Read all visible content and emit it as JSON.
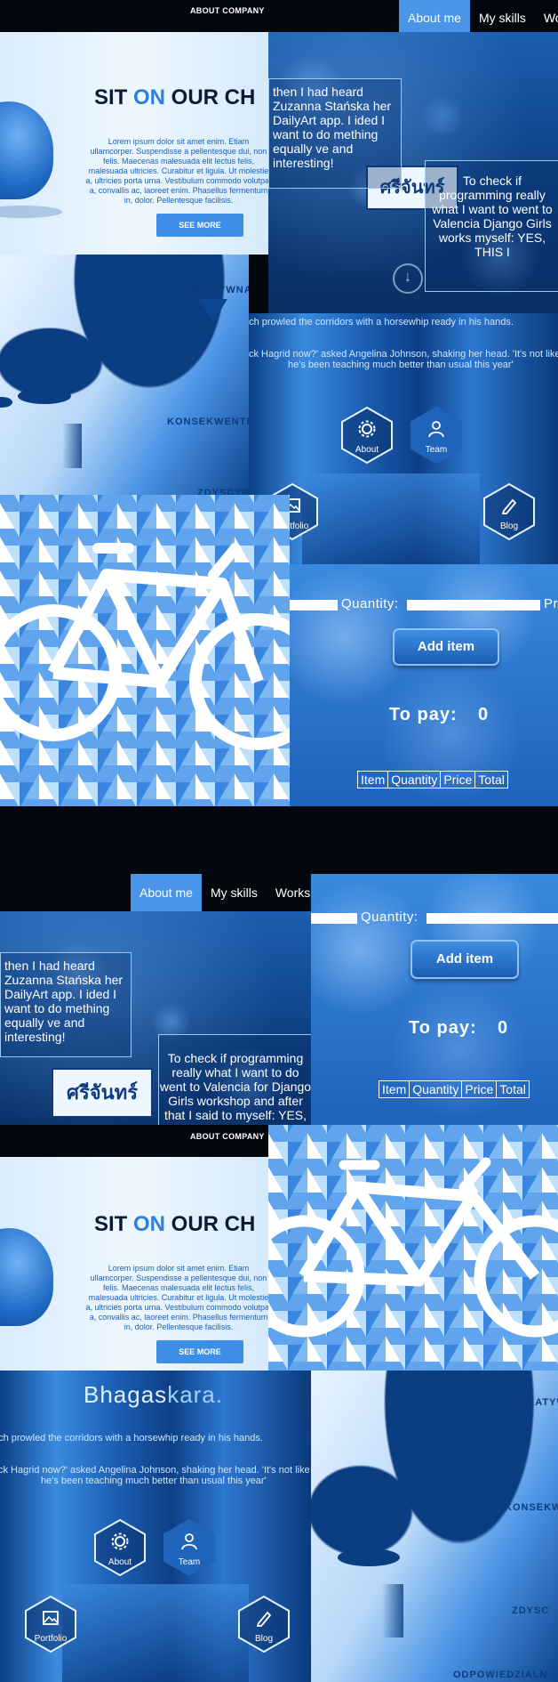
{
  "colors": {
    "accent": "#4a95e8",
    "deep_blue": "#0f4f99",
    "black": "#04070d",
    "white": "#ffffff"
  },
  "top_nav": {
    "about_company": "ABOUT COMPANY",
    "items": [
      {
        "label": "About me",
        "active": true
      },
      {
        "label": "My skills",
        "active": false
      },
      {
        "label": "Wo",
        "active": false
      }
    ]
  },
  "mid_nav": {
    "items": [
      {
        "label": "About me",
        "active": true
      },
      {
        "label": "My skills",
        "active": false
      },
      {
        "label": "Works",
        "active": false
      }
    ]
  },
  "hero": {
    "title_part1": "SIT ",
    "title_part2": "ON",
    "title_part3": " OUR CH",
    "body": "Lorem ipsum dolor sit amet enim. Etiam ullamcorper. Suspendisse a pellentesque dui, non felis. Maecenas malesuada elit lectus felis, malesuada ultricies. Curabitur et ligula. Ut molestie a, ultricies porta urna. Vestibulum commodo volutpat a, convallis ac, laoreet enim. Phasellus fermentum in, dolor. Pellentesque facilisis.",
    "button": "SEE MORE"
  },
  "hero_bottom": {
    "about_company": "ABOUT COMPANY",
    "title_part1": "SIT ",
    "title_part2": "ON",
    "title_part3": " OUR CH",
    "body": "Lorem ipsum dolor sit amet enim. Etiam ullamcorper. Suspendisse a pellentesque dui, non felis. Maecenas malesuada elit lectus felis, malesuada ultricies. Curabitur et ligula. Ut molestie a, ultricies porta urna. Vestibulum commodo volutpat a, convallis ac, laoreet enim. Phasellus fermentum in, dolor. Pellentesque facilisis.",
    "button": "SEE MORE"
  },
  "story": {
    "box1": "then I had heard Zuzanna Stańska her DailyArt app. I ided I want to do mething equally ve and interesting!",
    "box2": "To check if programming really what I want to went to Valencia Django Girls works myself: YES, THIS I",
    "sign": "ศรีจันทร์"
  },
  "story_bottom": {
    "box1": "then I had heard Zuzanna Stańska her DailyArt app. I ided I want to do mething equally ve and interesting!",
    "box2": "To check if programming really what I want to do went to Valencia for Django Girls workshop and after that I said to myself: YES, THIS IS IT",
    "sign": "ศรีจันทร์"
  },
  "values_words": [
    "KREATYWNA",
    "KONSEKWENTN",
    "ZDYSCYPL"
  ],
  "values_words_bottom": [
    "KREATYWN",
    "KONSEKWE",
    "ZDYSC",
    "ODPOWIEDZIALN"
  ],
  "agency": {
    "brand_part1": "Bhagas",
    "brand_part2": "kara.",
    "quote1": "rich prowled the corridors with a horsewhip ready in his hands.",
    "quote2": "ck Hagrid now?' asked Angelina Johnson, shaking her head. 'It's not like",
    "quote3": "he's been teaching much better than usual this year'",
    "hexes": [
      "About",
      "Team",
      "Portfolio",
      "Blog"
    ]
  },
  "cart": {
    "quantity_label": "Quantity:",
    "price_label": "Pr",
    "add_button": "Add item",
    "to_pay_label": "To pay:",
    "to_pay_value": "0",
    "columns": [
      "Item",
      "Quantity",
      "Price",
      "Total"
    ]
  },
  "cart_bottom": {
    "quantity_label": "Quantity:",
    "add_button": "Add item",
    "to_pay_label": "To pay:",
    "to_pay_value": "0",
    "columns": [
      "Item",
      "Quantity",
      "Price",
      "Total"
    ]
  }
}
